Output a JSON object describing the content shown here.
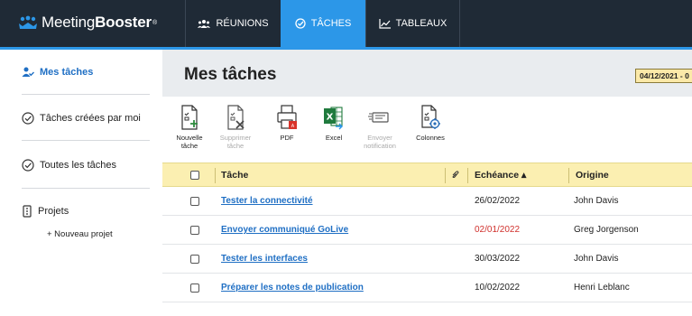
{
  "app": {
    "logo_light": "Meeting",
    "logo_bold": "Booster",
    "logo_mark": "®"
  },
  "nav": {
    "tabs": [
      {
        "label": "RÉUNIONS",
        "icon": "users-icon",
        "active": false
      },
      {
        "label": "TÂCHES",
        "icon": "check-circle-icon",
        "active": true
      },
      {
        "label": "TABLEAUX",
        "icon": "line-chart-icon",
        "active": false
      }
    ]
  },
  "sidebar": {
    "items": [
      {
        "label": "Mes tâches",
        "icon": "user-check-icon",
        "active": true
      },
      {
        "label": "Tâches créées par moi",
        "icon": "check-circle-icon",
        "active": false
      },
      {
        "label": "Toutes les tâches",
        "icon": "check-circle-icon",
        "active": false
      },
      {
        "label": "Projets",
        "icon": "project-icon",
        "active": false
      }
    ],
    "new_project": "+ Nouveau projet"
  },
  "main": {
    "title": "Mes tâches",
    "date_range": "04/12/2021 - 0"
  },
  "toolbar": {
    "new_task": [
      "Nouvelle",
      "tâche"
    ],
    "delete_task": [
      "Supprimer",
      "tâche"
    ],
    "pdf": "PDF",
    "excel": "Excel",
    "send_notification": [
      "Envoyer",
      "notification"
    ],
    "columns": "Colonnes"
  },
  "table": {
    "headers": {
      "task": "Tâche",
      "due": "Echéance ▴",
      "origin": "Origine"
    },
    "rows": [
      {
        "task": "Tester la connectivité",
        "due": "26/02/2022",
        "origin": "John Davis",
        "overdue": false
      },
      {
        "task": "Envoyer communiqué GoLive",
        "due": "02/01/2022",
        "origin": "Greg Jorgenson",
        "overdue": true
      },
      {
        "task": "Tester les interfaces",
        "due": "30/03/2022",
        "origin": "John Davis",
        "overdue": false
      },
      {
        "task": "Préparer les notes de publication",
        "due": "10/02/2022",
        "origin": "Henri Leblanc",
        "overdue": false
      }
    ]
  },
  "colors": {
    "nav_bg": "#1f2a36",
    "accent": "#2c97e8",
    "link": "#1f6fc4",
    "overdue": "#d0312d",
    "header_bg": "#fbefb1"
  }
}
